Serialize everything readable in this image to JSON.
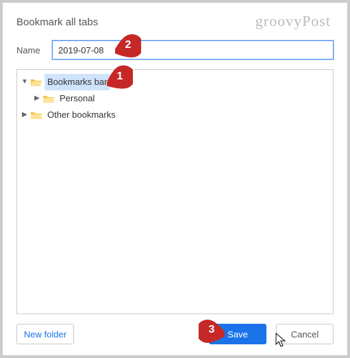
{
  "watermark": "groovyPost",
  "dialog": {
    "title": "Bookmark all tabs",
    "name_label": "Name",
    "name_value": "2019-07-08"
  },
  "tree": {
    "items": [
      {
        "label": "Bookmarks bar",
        "expanded": true,
        "selected": true,
        "children": [
          {
            "label": "Personal",
            "expanded": false
          }
        ]
      },
      {
        "label": "Other bookmarks",
        "expanded": false
      }
    ]
  },
  "buttons": {
    "new_folder": "New folder",
    "save": "Save",
    "cancel": "Cancel"
  },
  "callouts": {
    "one": "1",
    "two": "2",
    "three": "3"
  }
}
